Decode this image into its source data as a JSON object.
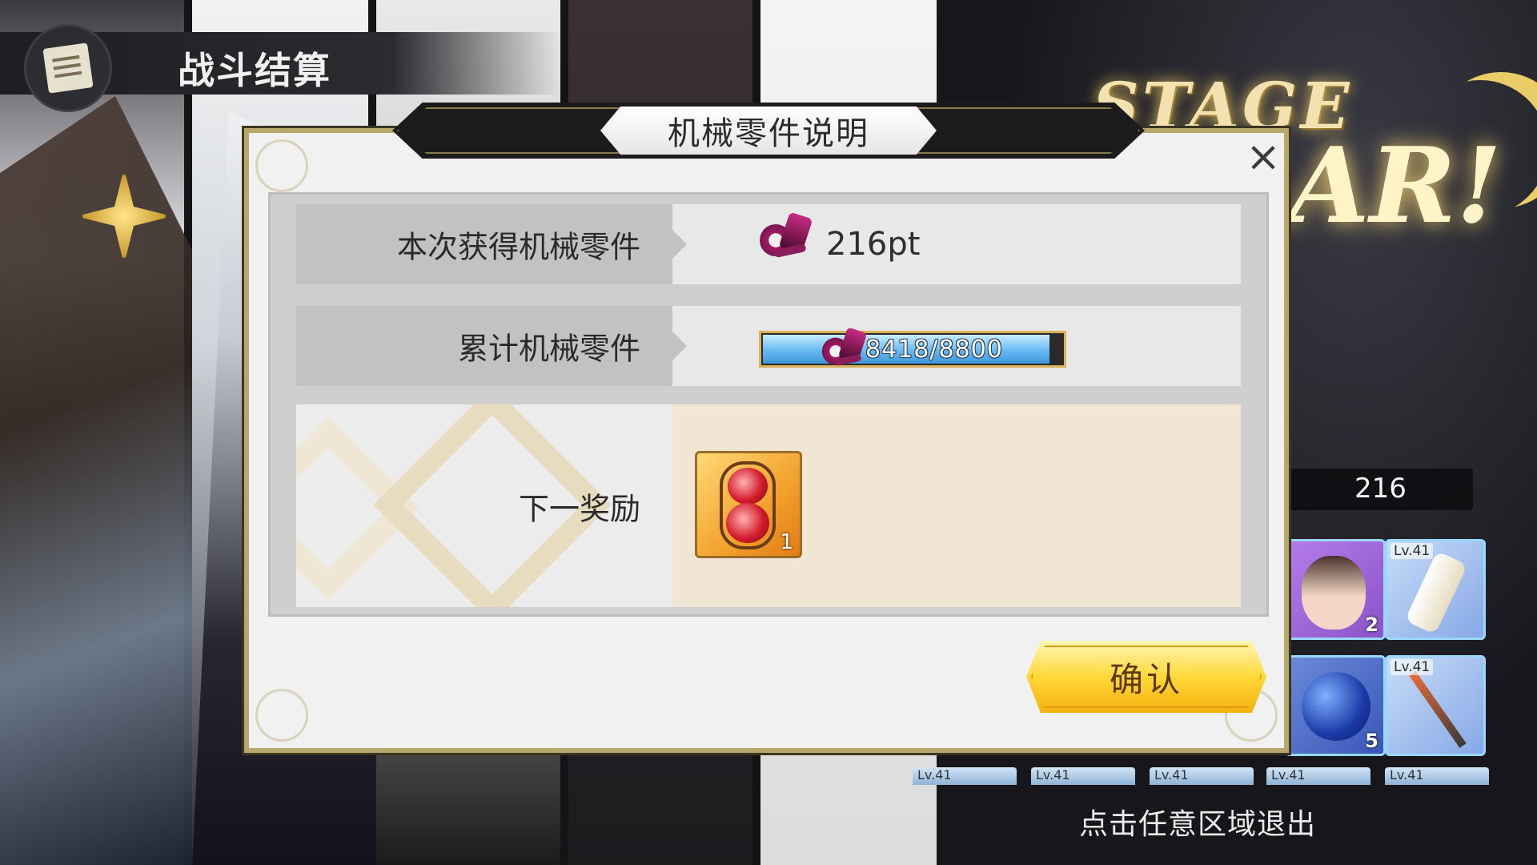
{
  "header": {
    "title": "战斗结算",
    "icon": "scroll-quill-icon"
  },
  "stage_banner": {
    "line1": "STAGE",
    "line2": "AR!"
  },
  "dialog": {
    "title": "机械零件说明",
    "close_label": "×",
    "rows": [
      {
        "label": "本次获得机械零件",
        "icon": "mech-parts-icon",
        "value": "216pt"
      },
      {
        "label": "累计机械零件",
        "icon": "mech-parts-icon",
        "progress_text": "8418/8800",
        "progress_fraction": 0.9566
      },
      {
        "label": "下一奖励",
        "reward": {
          "icon": "hourglass-icon",
          "quantity": "1"
        }
      }
    ],
    "confirm_label": "确认"
  },
  "result_panel": {
    "score": "216",
    "cards": [
      {
        "level": "",
        "count": "2",
        "icon": "character-portrait"
      },
      {
        "level": "Lv.41",
        "count": "",
        "icon": "scroll-weapon-icon"
      },
      {
        "level": "",
        "count": "5",
        "icon": "blue-gem-icon"
      },
      {
        "level": "Lv.41",
        "count": "",
        "icon": "spear-icon"
      }
    ],
    "mini_cards": [
      "Lv.41",
      "Lv.41",
      "Lv.41",
      "Lv.41",
      "Lv.41"
    ]
  },
  "exit_hint": "点击任意区域退出"
}
